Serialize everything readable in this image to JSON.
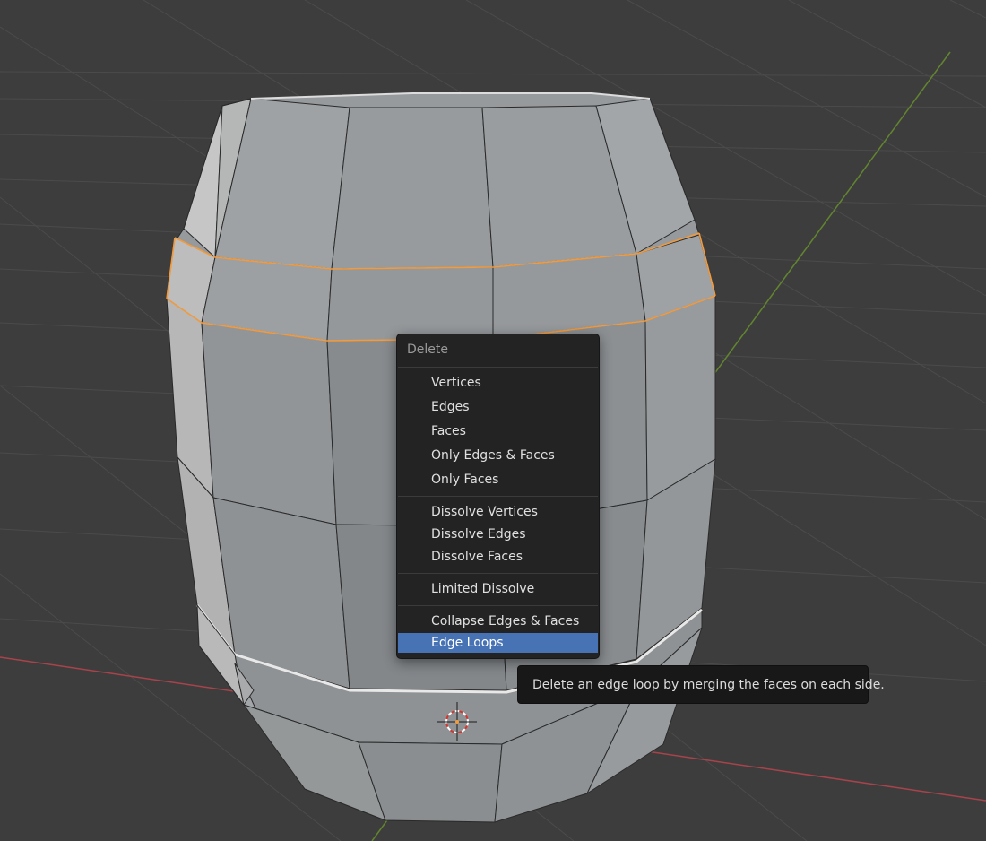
{
  "colors": {
    "viewport_bg": "#3d3d3d",
    "grid_line": "#4a4a4a",
    "x_axis": "#b3464e",
    "y_axis": "#6a8f34",
    "mesh_face": "#8f9396",
    "selection": "#f39a3c",
    "menu_bg": "#232323",
    "menu_highlight": "#4772b3",
    "tooltip_bg": "#181818"
  },
  "menu": {
    "title": "Delete",
    "groups": [
      [
        "Vertices",
        "Edges",
        "Faces",
        "Only Edges & Faces",
        "Only Faces"
      ],
      [
        "Dissolve Vertices",
        "Dissolve Edges",
        "Dissolve Faces"
      ],
      [
        "Limited Dissolve"
      ],
      [
        "Collapse Edges & Faces",
        "Edge Loops"
      ]
    ],
    "active_item": "Edge Loops"
  },
  "tooltip": {
    "text": "Delete an edge loop by merging the faces on each side."
  },
  "icons": {
    "cursor": "3d-cursor-icon"
  }
}
